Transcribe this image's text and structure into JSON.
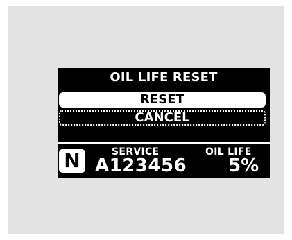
{
  "display": {
    "title": "OIL LIFE RESET",
    "menu": [
      {
        "label": "RESET",
        "state": "selected"
      },
      {
        "label": "CANCEL",
        "state": "unselected"
      }
    ],
    "status": {
      "gear": "N",
      "service_label": "SERVICE",
      "service_code": "A123456",
      "oil_life_label": "OIL LIFE",
      "oil_life_value": "5%"
    },
    "colors": {
      "panel_background": "#e3e3e3",
      "screen_background": "#000000",
      "text": "#ffffff"
    }
  }
}
